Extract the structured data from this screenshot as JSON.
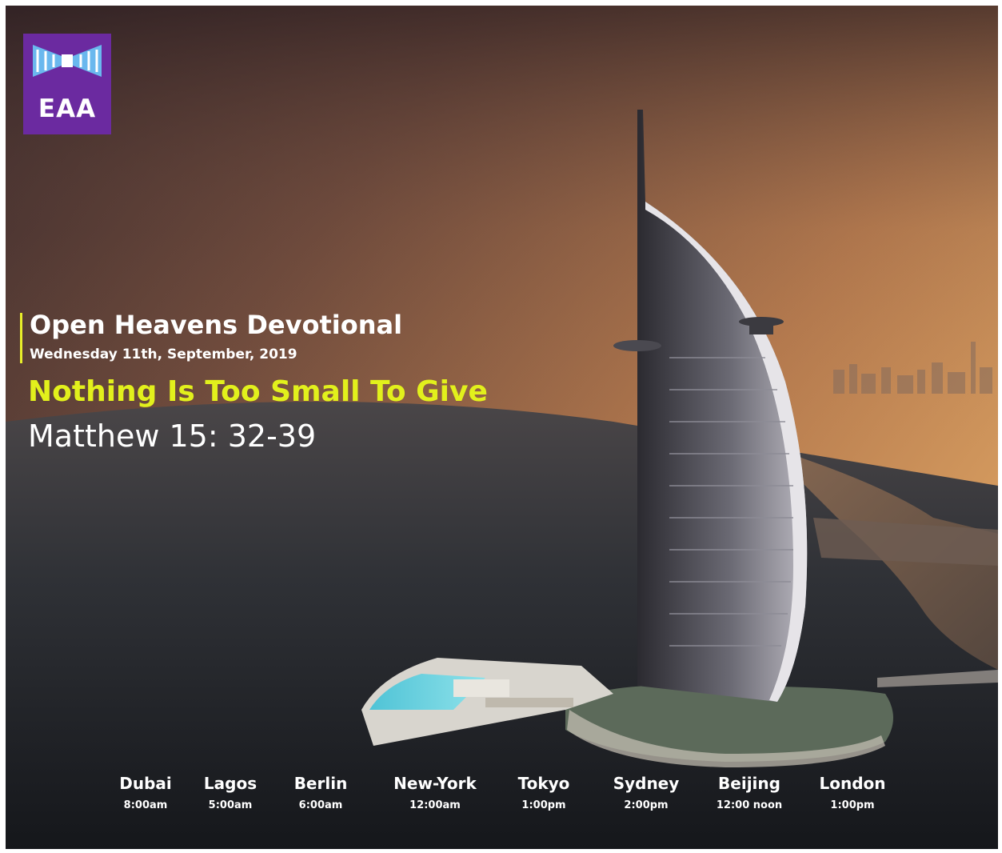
{
  "logo": {
    "text": "EAA",
    "colors": {
      "background": "#6b2aa0",
      "ribbon": "#6ab8ee"
    }
  },
  "devotional": {
    "title": "Open Heavens Devotional",
    "date": "Wednesday 11th, September, 2019",
    "headline": "Nothing Is Too Small To Give",
    "scripture": "Matthew 15: 32-39"
  },
  "schedule": [
    {
      "city": "Dubai",
      "time": "8:00am"
    },
    {
      "city": "Lagos",
      "time": "5:00am"
    },
    {
      "city": "Berlin",
      "time": "6:00am"
    },
    {
      "city": "New-York",
      "time": "12:00am"
    },
    {
      "city": "Tokyo",
      "time": "1:00pm"
    },
    {
      "city": "Sydney",
      "time": "2:00pm"
    },
    {
      "city": "Beijing",
      "time": "12:00 noon"
    },
    {
      "city": "London",
      "time": "1:00pm"
    }
  ],
  "colors": {
    "headline": "#e2f01c",
    "accent_bar": "#e8ef2a",
    "text": "#ffffff"
  }
}
